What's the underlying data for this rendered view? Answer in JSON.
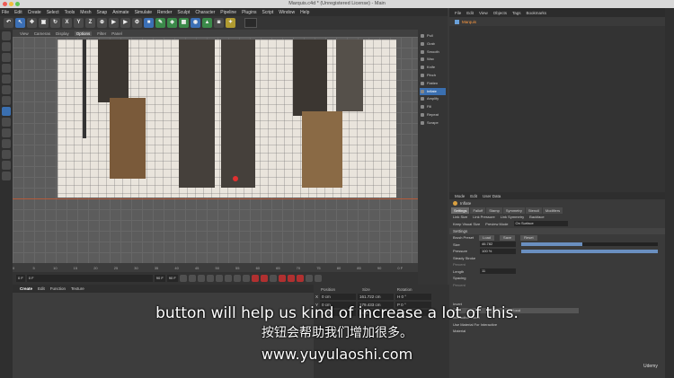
{
  "window": {
    "title": "Marquis.c4d * (Unregistered License) - Main",
    "layout_label": "Layout:",
    "layout_value": "Startup (User)"
  },
  "menubar": [
    "File",
    "Edit",
    "Create",
    "Select",
    "Tools",
    "Mesh",
    "Snap",
    "Animate",
    "Simulate",
    "Render",
    "Sculpt",
    "Character",
    "Pipeline",
    "Plugins",
    "Script",
    "Window",
    "Help"
  ],
  "toolbar": {
    "axis_x": "X",
    "axis_y": "Y",
    "axis_z": "Z"
  },
  "viewport": {
    "menu": [
      "View",
      "Cameras",
      "Display",
      "Options",
      "Filter",
      "Panel"
    ],
    "active_menu": "Options"
  },
  "sculpt_tools": [
    {
      "label": "Pull",
      "active": false
    },
    {
      "label": "Grab",
      "active": false
    },
    {
      "label": "Smooth",
      "active": false
    },
    {
      "label": "Wax",
      "active": false
    },
    {
      "label": "Knife",
      "active": false
    },
    {
      "label": "Pinch",
      "active": false
    },
    {
      "label": "Flatten",
      "active": false
    },
    {
      "label": "Inflate",
      "active": true
    },
    {
      "label": "Amplify",
      "active": false
    },
    {
      "label": "Fill",
      "active": false
    },
    {
      "label": "Repeat",
      "active": false
    },
    {
      "label": "Scrape",
      "active": false
    }
  ],
  "timeline": {
    "ticks": [
      "0",
      "5",
      "10",
      "15",
      "20",
      "25",
      "30",
      "35",
      "40",
      "45",
      "50",
      "55",
      "60",
      "65",
      "70",
      "75",
      "80",
      "85",
      "90"
    ],
    "end": "0 F"
  },
  "playbar": {
    "start": "0 F",
    "current": "0 F",
    "end": "90 F",
    "end2": "90 F"
  },
  "material": {
    "tabs": [
      "Create",
      "Edit",
      "Function",
      "Texture"
    ],
    "active": "Create"
  },
  "coords": {
    "headers": [
      "Position",
      "Size",
      "Rotation"
    ],
    "rows": [
      {
        "axis": "X",
        "pos": "0 cm",
        "size": "161.722 cm",
        "rot": "H  0 °"
      },
      {
        "axis": "Y",
        "pos": "0 cm",
        "size": "179.433 cm",
        "rot": "P  0 °"
      },
      {
        "axis": "Z",
        "pos": "0 cm",
        "size": "0 cm",
        "rot": "B  0 °"
      }
    ]
  },
  "objects": {
    "menu": [
      "File",
      "Edit",
      "View",
      "Objects",
      "Tags",
      "Bookmarks"
    ],
    "item": "Marquis"
  },
  "attributes": {
    "menu": [
      "Mode",
      "Edit",
      "User Data"
    ],
    "title": "Inflate",
    "tabs": [
      "Settings",
      "Falloff",
      "Stamp",
      "Symmetry",
      "Stencil",
      "Modifiers"
    ],
    "active_tab": "Settings",
    "link_size": "Link Size",
    "link_pressure": "Link Pressure",
    "link_symmetry": "Link Symmetry",
    "backface": "Backface",
    "keep_visual_size": "Keep Visual Size",
    "preview_mode_label": "Preview Mode",
    "preview_mode_value": "On Surface",
    "settings_header": "Settings",
    "brush_preset_label": "Brush Preset",
    "load": "Load",
    "save": "Save",
    "reset": "Reset",
    "size_label": "Size",
    "size_value": "46.782",
    "pressure_label": "Pressure",
    "pressure_value": "100 %",
    "size_fraction": 0.45,
    "pressure_fraction": 1.0,
    "steady_stroke": "Steady Stroke",
    "percent_label": "Percent",
    "length_label": "Length",
    "length_value": "11",
    "spacing_label": "Spacing",
    "percent2_label": "Percent",
    "invert": "Invert",
    "flood": "Flood",
    "interactive_flood": "Interactive Flood",
    "use_material": "Use Material For Interactive",
    "material_label": "Material"
  },
  "subtitles": {
    "en": "button will help us kind of increase a lot of this.",
    "cn": "按钮会帮助我们增加很多。",
    "url": "www.yuyulaoshi.com"
  },
  "watermark": "Udemy"
}
